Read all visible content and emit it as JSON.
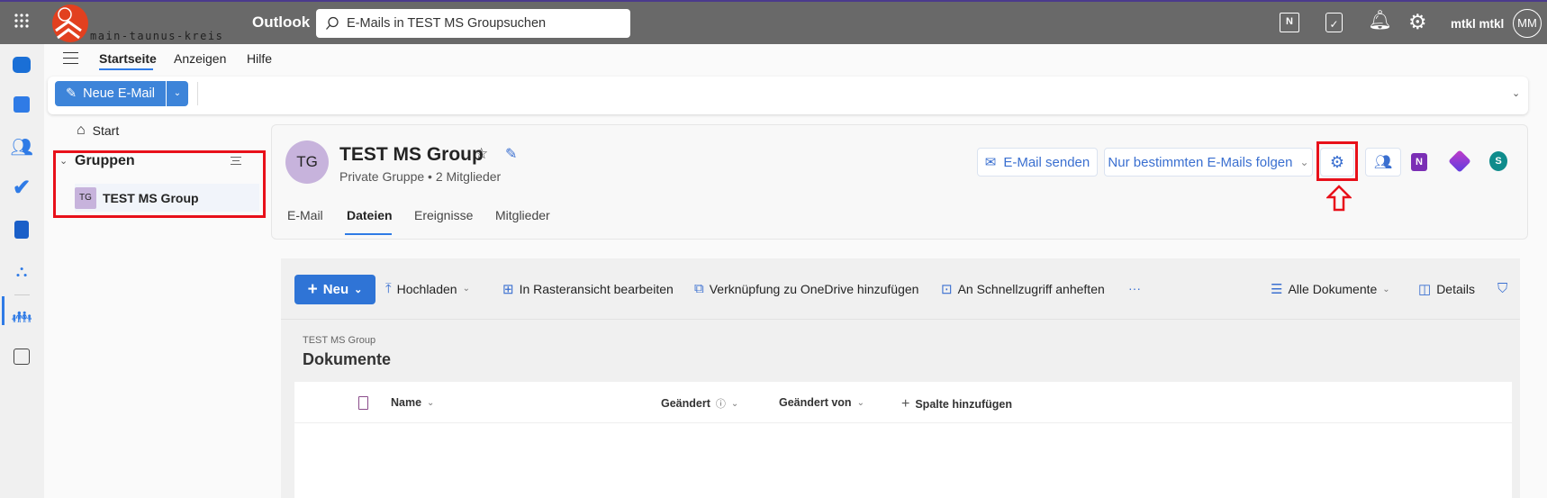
{
  "topbar": {
    "logo_text": "main-taunus-kreis",
    "app_name": "Outlook",
    "search_placeholder": "E-Mails in TEST MS Groupsuchen",
    "user_name": "mtkl mtkl",
    "avatar_initials": "MM",
    "icons": [
      "onenote-feed-icon",
      "my-day-icon",
      "bell-icon",
      "gear-icon"
    ]
  },
  "menu": {
    "tabs": [
      {
        "label": "Startseite",
        "active": true
      },
      {
        "label": "Anzeigen"
      },
      {
        "label": "Hilfe"
      }
    ]
  },
  "ribbon": {
    "new_mail_label": "Neue E-Mail"
  },
  "left_nav": {
    "start_label": "Start",
    "groups_label": "Gruppen",
    "group_item": {
      "initials": "TG",
      "label": "TEST MS Group"
    }
  },
  "group_header": {
    "initials": "TG",
    "title": "TEST MS Group",
    "subtitle": "Private Gruppe • 2 Mitglieder",
    "tabs": [
      {
        "label": "E-Mail"
      },
      {
        "label": "Dateien",
        "active": true
      },
      {
        "label": "Ereignisse"
      },
      {
        "label": "Mitglieder"
      }
    ],
    "send_mail_label": "E-Mail senden",
    "follow_label": "Nur bestimmten E-Mails folgen"
  },
  "files": {
    "commands": {
      "new": "Neu",
      "upload": "Hochladen",
      "grid_edit": "In Rasteransicht bearbeiten",
      "onedrive_link": "Verknüpfung zu OneDrive hinzufügen",
      "pin": "An Schnellzugriff anheften",
      "more": "···",
      "view": "Alle Dokumente",
      "details": "Details"
    },
    "breadcrumb": "TEST MS Group",
    "title": "Dokumente",
    "columns": {
      "name": "Name",
      "modified": "Geändert",
      "modified_by": "Geändert von",
      "add_column": "Spalte hinzufügen"
    }
  },
  "colors": {
    "accent": "#2f7be6",
    "topbar": "#696969",
    "highlight": "#e8101a",
    "avatar": "#c7b3dc"
  }
}
